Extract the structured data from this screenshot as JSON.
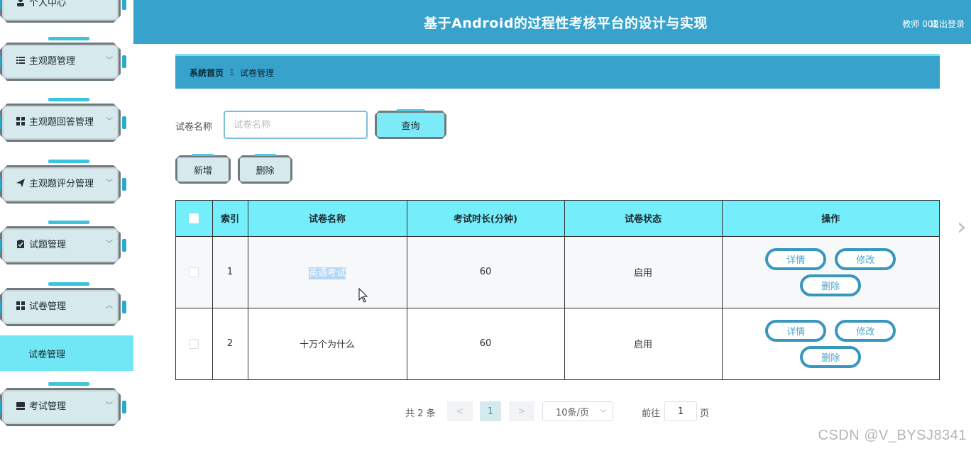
{
  "header": {
    "title": "基于Android的过程性考核平台的设计与实现",
    "user": "教师 001",
    "logout": "退出登录"
  },
  "sidebar": {
    "items": [
      {
        "label": "个人中心",
        "icon": "user-icon"
      },
      {
        "label": "主观题管理",
        "icon": "list-icon"
      },
      {
        "label": "主观题回答管理",
        "icon": "grid-icon"
      },
      {
        "label": "主观题评分管理",
        "icon": "send-icon"
      },
      {
        "label": "试题管理",
        "icon": "clipboard-check-icon"
      },
      {
        "label": "试卷管理",
        "icon": "grid-icon"
      },
      {
        "label": "考试管理",
        "icon": "inbox-icon"
      }
    ],
    "active_sub": "试卷管理"
  },
  "breadcrumb": {
    "home": "系统首页",
    "separator": "Ξ",
    "current": "试卷管理"
  },
  "search": {
    "label": "试卷名称",
    "placeholder": "试卷名称",
    "value": "",
    "button": "查询"
  },
  "actions": {
    "add": "新增",
    "delete": "删除"
  },
  "table": {
    "columns": [
      "索引",
      "试卷名称",
      "考试时长(分钟)",
      "试卷状态",
      "操作"
    ],
    "rows": [
      {
        "index": "1",
        "name": "英语考试",
        "duration": "60",
        "status": "启用"
      },
      {
        "index": "2",
        "name": "十万个为什么",
        "duration": "60",
        "status": "启用"
      }
    ],
    "ops": {
      "detail": "详情",
      "edit": "修改",
      "delete": "删除"
    }
  },
  "pagination": {
    "total": "共 2 条",
    "prev": "<",
    "current": "1",
    "next": ">",
    "page_size": "10条/页",
    "goto_label": "前往",
    "goto_value": "1",
    "page_unit": "页"
  },
  "watermark": "CSDN @V_BYSJ8341",
  "colors": {
    "header": "#37a2cc",
    "table_header": "#73eefa",
    "active_sub": "#71e6f4",
    "pill_border": "#3797bf"
  }
}
